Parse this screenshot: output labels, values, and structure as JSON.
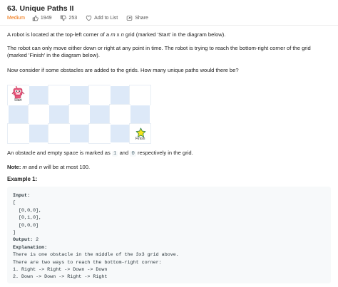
{
  "header": {
    "title": "63. Unique Paths II",
    "difficulty": "Medium",
    "likes": "1949",
    "dislikes": "253",
    "add_to_list": "Add to List",
    "share": "Share"
  },
  "description": {
    "p1_a": "A robot is located at the top-left corner of a ",
    "p1_m": "m",
    "p1_x": " x ",
    "p1_n": "n",
    "p1_b": " grid (marked 'Start' in the diagram below).",
    "p2": "The robot can only move either down or right at any point in time. The robot is trying to reach the bottom-right corner of the grid (marked 'Finish' in the diagram below).",
    "p3": "Now consider if some obstacles are added to the grids. How many unique paths would there be?",
    "p4_a": "An obstacle and empty space is marked as ",
    "p4_code1": "1",
    "p4_and": " and ",
    "p4_code2": "0",
    "p4_b": " respectively in the grid.",
    "note_label": "Note:",
    "note_m": "m",
    "note_and": " and ",
    "note_n": "n",
    "note_rest": " will be at most 100."
  },
  "diagram": {
    "start_label": "Start",
    "finish_label": "Finish"
  },
  "example": {
    "heading": "Example 1:",
    "input_label": "Input:",
    "input_lines": [
      "[",
      "  [0,0,0],",
      "  [0,1,0],",
      "  [0,0,0]",
      "]"
    ],
    "output_label": "Output:",
    "output_value": " 2",
    "explanation_label": "Explanation:",
    "explanation_lines": [
      "There is one obstacle in the middle of the 3x3 grid above.",
      "There are two ways to reach the bottom-right corner:",
      "1. Right -> Right -> Down -> Down",
      "2. Down -> Down -> Right -> Right"
    ]
  },
  "colors": {
    "difficulty": "#ef6c00",
    "grid_blue": "#dde9f8",
    "star": "#f5e31b"
  }
}
